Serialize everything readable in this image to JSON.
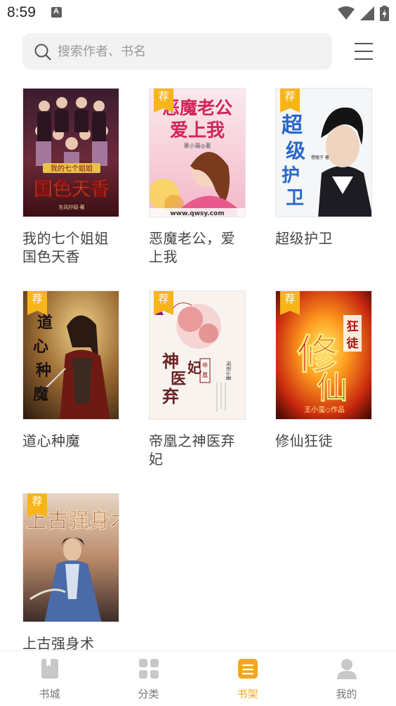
{
  "status": {
    "time": "8:59",
    "notification_icon": "text-a-icon",
    "right_icons": [
      "wifi-icon",
      "signal-icon",
      "battery-charging-icon"
    ]
  },
  "search": {
    "placeholder": "搜索作者、书名",
    "value": ""
  },
  "badge_label": "荐",
  "books": [
    {
      "title": "我的七个姐姐国色天香",
      "badge": false,
      "cover_text": "国色天香",
      "cover_subtitle": "我的七个姐姐",
      "cover_author": "东风拧砚·著"
    },
    {
      "title": "恶魔老公，爱上我",
      "badge": true,
      "cover_text": "恶魔老公爱上我",
      "cover_author": "萧小薇◎著",
      "cover_footer": "www.qwsy.com"
    },
    {
      "title": "超级护卫",
      "badge": true,
      "cover_text": "超级护卫",
      "cover_author": "橙瞳子 著"
    },
    {
      "title": "道心种魔",
      "badge": true,
      "cover_text": "道心种魔"
    },
    {
      "title": "帝凰之神医弃妃",
      "badge": true,
      "cover_text": "神医弃妃",
      "cover_small": "帝凰",
      "cover_author": "阿彩◎著"
    },
    {
      "title": "修仙狂徒",
      "badge": true,
      "cover_text": "修仙",
      "cover_small": "狂徒",
      "cover_author": "王小蛮◇作品"
    },
    {
      "title": "上古强身术",
      "badge": true,
      "cover_text": "上古强身术"
    }
  ],
  "nav": [
    {
      "label": "书城",
      "icon": "bookstore-icon",
      "active": false
    },
    {
      "label": "分类",
      "icon": "category-grid-icon",
      "active": false
    },
    {
      "label": "书架",
      "icon": "bookshelf-icon",
      "active": true
    },
    {
      "label": "我的",
      "icon": "profile-icon",
      "active": false
    }
  ],
  "colors": {
    "accent": "#f5a623",
    "badge": "#f7b51a",
    "nav_inactive": "#c8c8c8",
    "search_bg": "#f2f2f2"
  }
}
